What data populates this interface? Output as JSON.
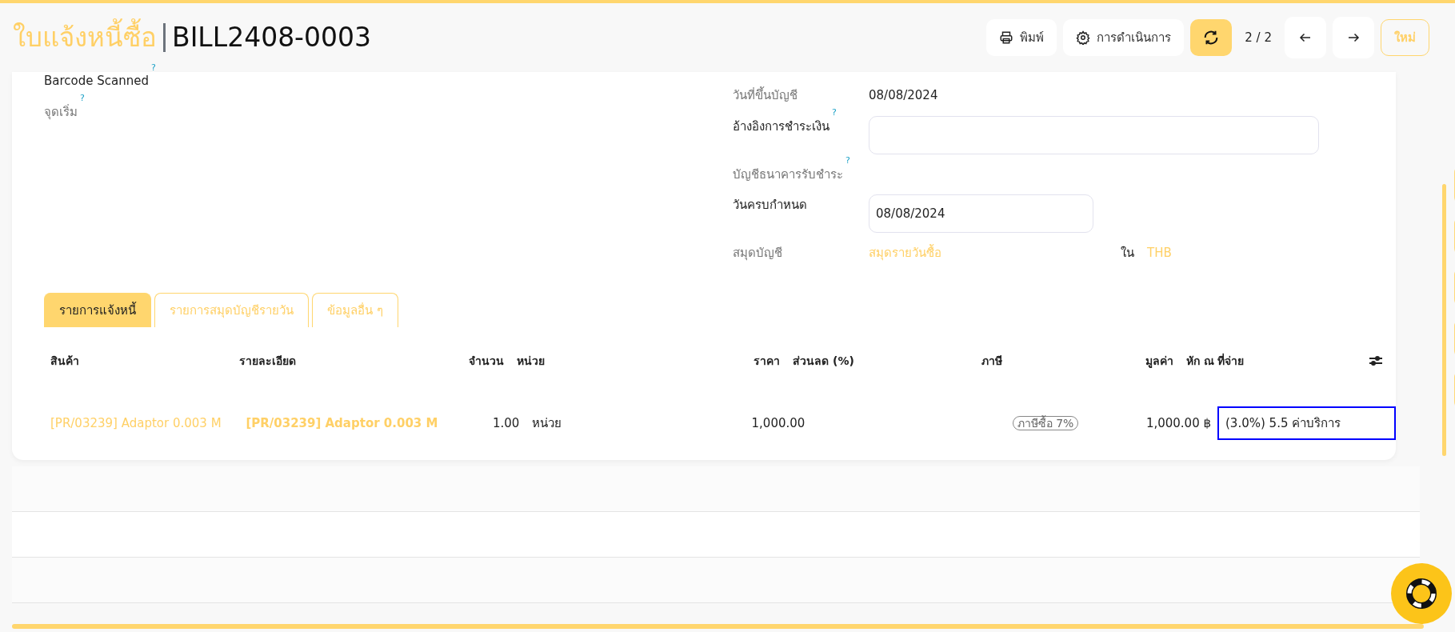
{
  "header": {
    "breadcrumb": "ใบแจ้งหนี้ซื้อ",
    "record": "BILL2408-0003"
  },
  "toolbar": [
    {
      "kind": "print",
      "label": "พิมพ์"
    },
    {
      "kind": "actions",
      "label": "การดำเนินการ"
    },
    {
      "kind": "refresh"
    },
    {
      "kind": "pager",
      "label": "2 / 2"
    },
    {
      "kind": "prev"
    },
    {
      "kind": "next"
    },
    {
      "kind": "new",
      "label": "ใหม่"
    }
  ],
  "left_fields": [
    {
      "label": "Barcode Scanned",
      "help": "?",
      "required": true
    },
    {
      "label": "จุดเริ่ม",
      "help": "?",
      "required": false
    }
  ],
  "right_fields": [
    {
      "kind": "text",
      "label": "วันที่ขึ้นบัญชี",
      "required": false,
      "value": "08/08/2024"
    },
    {
      "kind": "textarea",
      "label": "อ้างอิงการชำระเงิน",
      "required": true,
      "help": "?"
    },
    {
      "kind": "empty",
      "label": "บัญชีธนาคารรับชำระ",
      "required": false,
      "help": "?"
    },
    {
      "kind": "date",
      "label": "วันครบกำหนด",
      "required": true,
      "value": "08/08/2024"
    },
    {
      "kind": "journal",
      "label": "สมุดบัญชี",
      "required": false,
      "value": "สมุดรายวันซื้อ",
      "currency_prefix": "ใน",
      "currency": "THB"
    }
  ],
  "tabs": [
    {
      "label": "รายการแจ้งหนี้",
      "selected": true
    },
    {
      "label": "รายการสมุดบัญชีรายวัน",
      "selected": false
    },
    {
      "label": "ข้อมูลอื่น ๆ",
      "selected": false
    }
  ],
  "table": {
    "columns": [
      "สินค้า",
      "รายละเอียด",
      "จำนวน",
      "หน่วย",
      "ราคา",
      "ส่วนลด (%)",
      "ภาษี",
      "มูลค่า",
      "หัก ณ ที่จ่าย"
    ],
    "rows": [
      {
        "product": "[PR/03239] Adaptor 0.003 M",
        "description": "[PR/03239] Adaptor 0.003 M",
        "quantity": "1.00",
        "unit": "หน่วย",
        "price": "1,000.00",
        "tax": "ภาษีซื้อ 7%",
        "amount": "1,000.00 ฿",
        "withholding": "(3.0%) 5.5 ค่าบริการ",
        "withholding_focused": true
      }
    ]
  }
}
